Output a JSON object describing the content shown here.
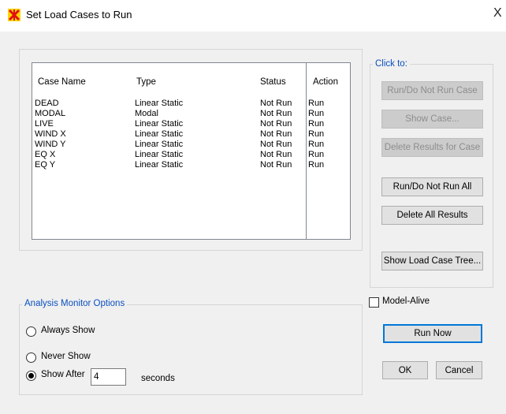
{
  "window": {
    "title": "Set Load Cases to Run",
    "close_glyph": "X"
  },
  "cases_list": {
    "headers": {
      "case_name": "Case Name",
      "type": "Type",
      "status": "Status",
      "action": "Action"
    },
    "rows": [
      {
        "case_name": "DEAD",
        "type": "Linear Static",
        "status": "Not Run",
        "action": "Run"
      },
      {
        "case_name": "MODAL",
        "type": "Modal",
        "status": "Not Run",
        "action": "Run"
      },
      {
        "case_name": "LIVE",
        "type": "Linear Static",
        "status": "Not Run",
        "action": "Run"
      },
      {
        "case_name": "WIND X",
        "type": "Linear Static",
        "status": "Not Run",
        "action": "Run"
      },
      {
        "case_name": "WIND Y",
        "type": "Linear Static",
        "status": "Not Run",
        "action": "Run"
      },
      {
        "case_name": "EQ X",
        "type": "Linear Static",
        "status": "Not Run",
        "action": "Run"
      },
      {
        "case_name": "EQ Y",
        "type": "Linear Static",
        "status": "Not Run",
        "action": "Run"
      }
    ]
  },
  "click_to": {
    "legend": "Click to:",
    "run_do_not_run_case": "Run/Do Not Run Case",
    "show_case": "Show Case...",
    "delete_results_for_case": "Delete Results for Case",
    "run_do_not_run_all": "Run/Do Not Run All",
    "delete_all_results": "Delete All Results",
    "show_load_case_tree": "Show Load Case Tree..."
  },
  "analysis_monitor": {
    "legend": "Analysis Monitor Options",
    "always_show": "Always Show",
    "never_show": "Never Show",
    "show_after": "Show After",
    "show_after_value": "4",
    "seconds": "seconds",
    "selected": "show_after"
  },
  "model_alive": {
    "label": "Model-Alive",
    "checked": false
  },
  "actions": {
    "run_now": "Run Now",
    "ok": "OK",
    "cancel": "Cancel"
  },
  "colors": {
    "legend_text": "#0a4fbf",
    "dialog_bg": "#f0f0f0",
    "default_button_border": "#0078d7"
  }
}
